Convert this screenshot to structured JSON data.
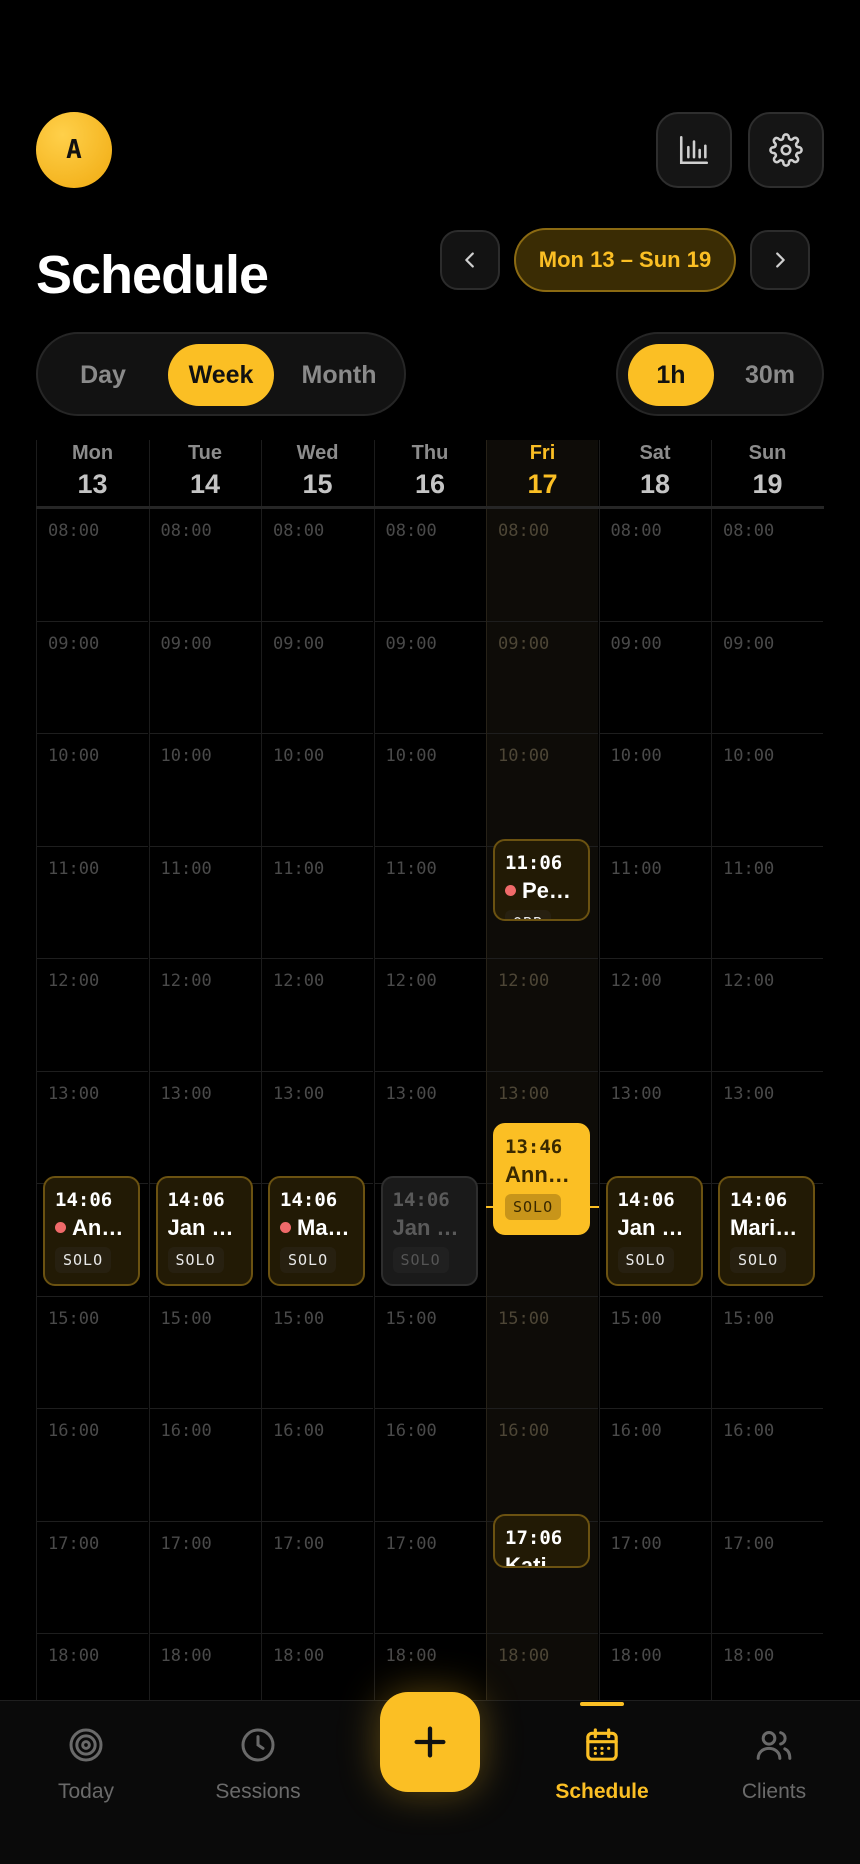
{
  "header": {
    "avatar_initial": "A",
    "stats_icon": "bar-chart-icon",
    "settings_icon": "gear-icon"
  },
  "title": "Schedule",
  "range": {
    "label": "Mon 13 – Sun 19",
    "prev_icon": "chevron-left-icon",
    "next_icon": "chevron-right-icon"
  },
  "view_modes": {
    "items": [
      "Day",
      "Week",
      "Month"
    ],
    "selected": "Week"
  },
  "intervals": {
    "items": [
      "1h",
      "30m"
    ],
    "selected": "1h"
  },
  "days": [
    {
      "dow": "Mon",
      "num": "13"
    },
    {
      "dow": "Tue",
      "num": "14"
    },
    {
      "dow": "Wed",
      "num": "15"
    },
    {
      "dow": "Thu",
      "num": "16"
    },
    {
      "dow": "Fri",
      "num": "17",
      "today": true
    },
    {
      "dow": "Sat",
      "num": "18"
    },
    {
      "dow": "Sun",
      "num": "19"
    }
  ],
  "hours": [
    "08:00",
    "09:00",
    "10:00",
    "11:00",
    "12:00",
    "13:00",
    "14:00",
    "15:00",
    "16:00",
    "17:00",
    "18:00"
  ],
  "events": [
    {
      "day": 0,
      "time": "14:06",
      "name": "An…",
      "dot": true,
      "badge": "SOLO",
      "state": "normal"
    },
    {
      "day": 1,
      "time": "14:06",
      "name": "Jan …",
      "dot": false,
      "badge": "SOLO",
      "state": "normal"
    },
    {
      "day": 2,
      "time": "14:06",
      "name": "Ma…",
      "dot": true,
      "badge": "SOLO",
      "state": "normal"
    },
    {
      "day": 3,
      "time": "14:06",
      "name": "Jan …",
      "dot": false,
      "badge": "SOLO",
      "state": "dim"
    },
    {
      "day": 5,
      "time": "14:06",
      "name": "Jan …",
      "dot": false,
      "badge": "SOLO",
      "state": "normal"
    },
    {
      "day": 6,
      "time": "14:06",
      "name": "Mari…",
      "dot": false,
      "badge": "SOLO",
      "state": "normal"
    },
    {
      "day": 4,
      "time": "11:06",
      "name": "Pe…",
      "dot": true,
      "badge": "OBB",
      "state": "normal"
    },
    {
      "day": 4,
      "time": "13:46",
      "name": "Ann…",
      "dot": false,
      "badge": "SOLO",
      "state": "current"
    },
    {
      "day": 4,
      "time": "17:06",
      "name": "Kati …",
      "dot": false,
      "badge": "",
      "state": "normal"
    }
  ],
  "tabs": [
    {
      "label": "Today",
      "icon": "target-icon"
    },
    {
      "label": "Sessions",
      "icon": "clock-icon"
    },
    {
      "label": "Schedule",
      "icon": "calendar-icon",
      "active": true
    },
    {
      "label": "Clients",
      "icon": "users-icon"
    }
  ],
  "fab": {
    "icon": "plus-icon"
  },
  "colors": {
    "accent": "#fbbf24",
    "background": "#000000",
    "dot": "#f06a6a"
  }
}
